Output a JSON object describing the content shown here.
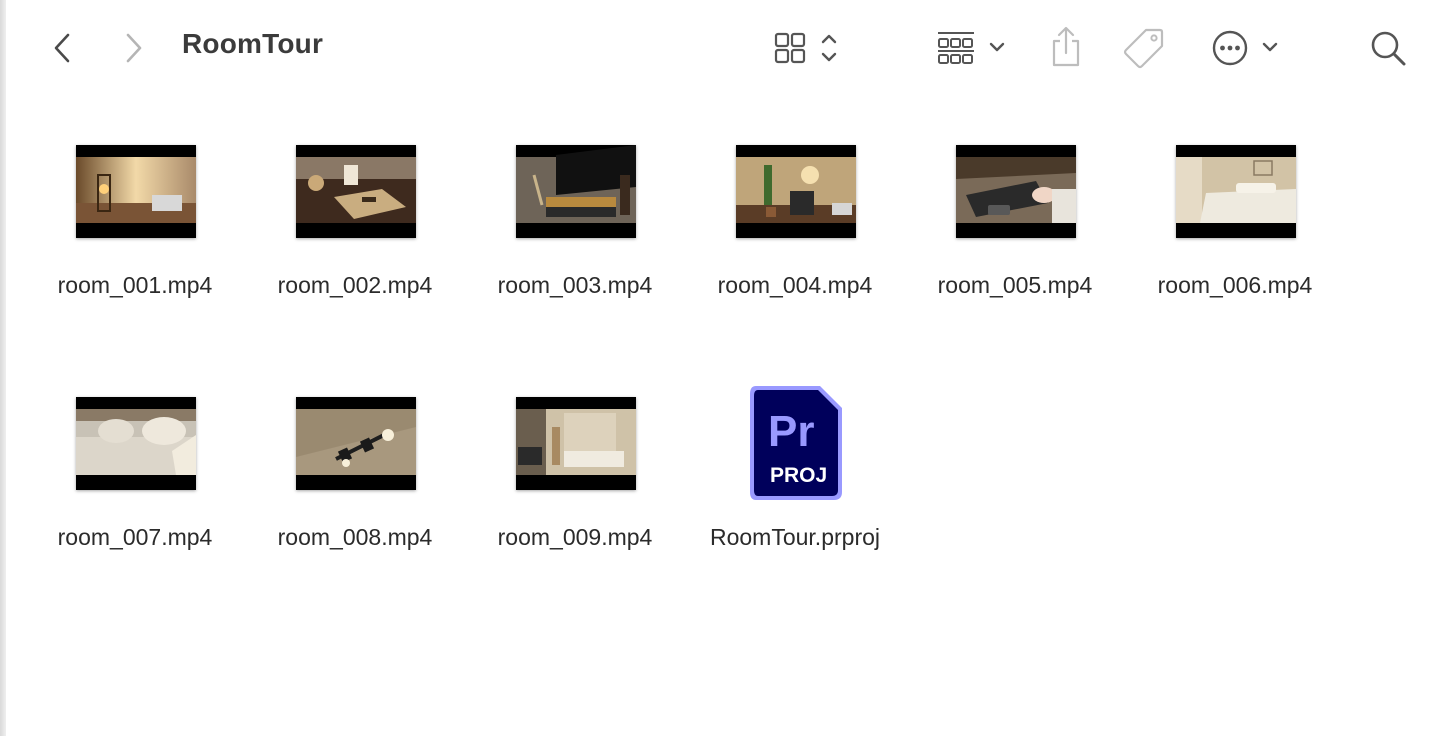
{
  "window": {
    "title": "RoomTour"
  },
  "toolbar": {
    "back_icon": "chevron-left-icon",
    "forward_icon": "chevron-right-icon",
    "view_icon": "icon-grid-view-icon",
    "group_icon": "group-by-icon",
    "share_icon": "share-icon",
    "tag_icon": "tag-icon",
    "more_icon": "ellipsis-circle-icon",
    "search_icon": "magnifying-glass-icon"
  },
  "files": [
    {
      "name": "room_001.mp4",
      "kind": "video",
      "scene": "lantern on desk"
    },
    {
      "name": "room_002.mp4",
      "kind": "video",
      "scene": "wooden tray with candle"
    },
    {
      "name": "room_003.mp4",
      "kind": "video",
      "scene": "tv stand"
    },
    {
      "name": "room_004.mp4",
      "kind": "video",
      "scene": "plant and shelf"
    },
    {
      "name": "room_005.mp4",
      "kind": "video",
      "scene": "typing on keyboard"
    },
    {
      "name": "room_006.mp4",
      "kind": "video",
      "scene": "bed"
    },
    {
      "name": "room_007.mp4",
      "kind": "video",
      "scene": "sofa with cushions"
    },
    {
      "name": "room_008.mp4",
      "kind": "video",
      "scene": "ceiling spotlights"
    },
    {
      "name": "room_009.mp4",
      "kind": "video",
      "scene": "room overview"
    },
    {
      "name": "RoomTour.prproj",
      "kind": "premiere-project",
      "icon_text_top": "Pr",
      "icon_text_bottom": "PROJ"
    }
  ],
  "colors": {
    "premiere_bg": "#00005b",
    "premiere_border": "#9999ff",
    "premiere_text": "#9999ff"
  }
}
